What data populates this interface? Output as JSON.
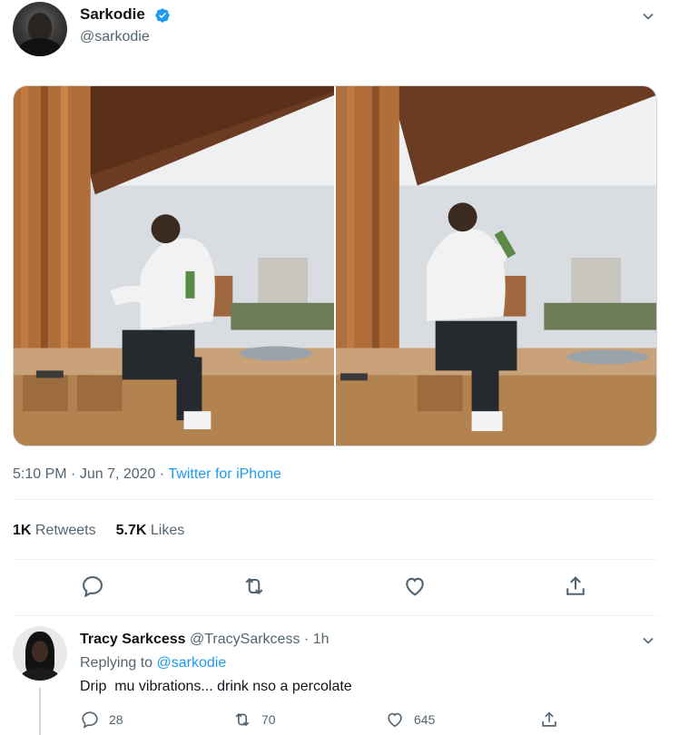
{
  "tweet": {
    "author_name": "Sarkodie",
    "author_handle": "@sarkodie",
    "verified_color": "#1d9bf0",
    "images": [
      {
        "subject": "man in white hoodie seated on wooden ledge, holding green bottle"
      },
      {
        "subject": "man in white hoodie drinking from green bottle"
      }
    ],
    "time": "5:10 PM",
    "date": "Jun 7, 2020",
    "separator": "·",
    "source": "Twitter for iPhone",
    "retweets_count": "1K",
    "retweets_label": "Retweets",
    "likes_count": "5.7K",
    "likes_label": "Likes",
    "actions": [
      "reply-icon",
      "retweet-icon",
      "like-icon",
      "share-icon"
    ]
  },
  "reply": {
    "author_name": "Tracy Sarkcess",
    "author_handle": "@TracySarkcess",
    "separator": "·",
    "age": "1h",
    "replying_prefix": "Replying to",
    "replying_mention": "@sarkodie",
    "text": "Drip  mu vibrations... drink nso a percolate",
    "reply_count": "28",
    "retweet_count": "70",
    "like_count": "645"
  },
  "colors": {
    "accent": "#1d9bf0",
    "secondary_text": "#536471",
    "primary_text": "#0f1419"
  }
}
